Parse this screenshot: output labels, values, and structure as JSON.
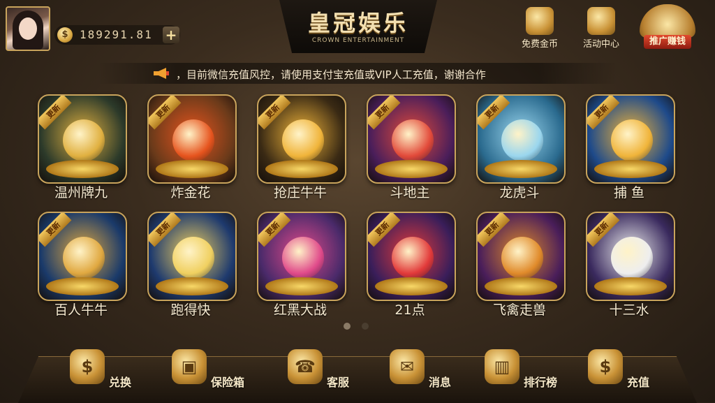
{
  "header": {
    "balance": "189291.81",
    "coin_symbol": "$",
    "add_symbol": "+",
    "logo_title": "皇冠娱乐",
    "logo_subtitle": "CROWN ENTERTAINMENT",
    "free_coins": "免费金币",
    "events": "活动中心",
    "promo": "推广赚钱"
  },
  "notice": "，目前微信充值风控，请使用支付宝充值或VIP人工充值，谢谢合作",
  "badge_text": "更新",
  "games": [
    {
      "name": "温州牌九",
      "bg": "#2c3a2a",
      "accent": "#e0b040"
    },
    {
      "name": "炸金花",
      "bg": "#6a3a1a",
      "accent": "#e6541e"
    },
    {
      "name": "抢庄牛牛",
      "bg": "#3a2a14",
      "accent": "#f0b43a"
    },
    {
      "name": "斗地主",
      "bg": "#4a1e5a",
      "accent": "#e24a3a"
    },
    {
      "name": "龙虎斗",
      "bg": "#2a6a8e",
      "accent": "#9ad6ee"
    },
    {
      "name": "捕 鱼",
      "bg": "#1e4a8a",
      "accent": "#f0b43a"
    },
    {
      "name": "百人牛牛",
      "bg": "#1a3a6a",
      "accent": "#e0a840"
    },
    {
      "name": "跑得快",
      "bg": "#1e3a6e",
      "accent": "#f0d060"
    },
    {
      "name": "红黑大战",
      "bg": "#4a2a6a",
      "accent": "#e04a8a"
    },
    {
      "name": "21点",
      "bg": "#3a1e5a",
      "accent": "#e23a3a"
    },
    {
      "name": "飞禽走兽",
      "bg": "#4a1e5a",
      "accent": "#e08a2a"
    },
    {
      "name": "十三水",
      "bg": "#3a2a5e",
      "accent": "#eeeeee"
    }
  ],
  "pagination": {
    "pages": 2,
    "current": 1
  },
  "bottom_nav": [
    {
      "label": "兑换",
      "icon": "$",
      "icon_name": "exchange-coin-icon"
    },
    {
      "label": "保险箱",
      "icon": "▣",
      "icon_name": "safe-box-icon"
    },
    {
      "label": "客服",
      "icon": "☎",
      "icon_name": "customer-service-phone-icon"
    },
    {
      "label": "消息",
      "icon": "✉",
      "icon_name": "message-envelope-icon"
    },
    {
      "label": "排行榜",
      "icon": "▥",
      "icon_name": "leaderboard-podium-icon"
    },
    {
      "label": "充值",
      "icon": "$",
      "icon_name": "recharge-coin-icon"
    }
  ],
  "colors": {
    "gold": "#c9a45c",
    "badge": "#f3c85e",
    "promo_red": "#e24a2e"
  }
}
